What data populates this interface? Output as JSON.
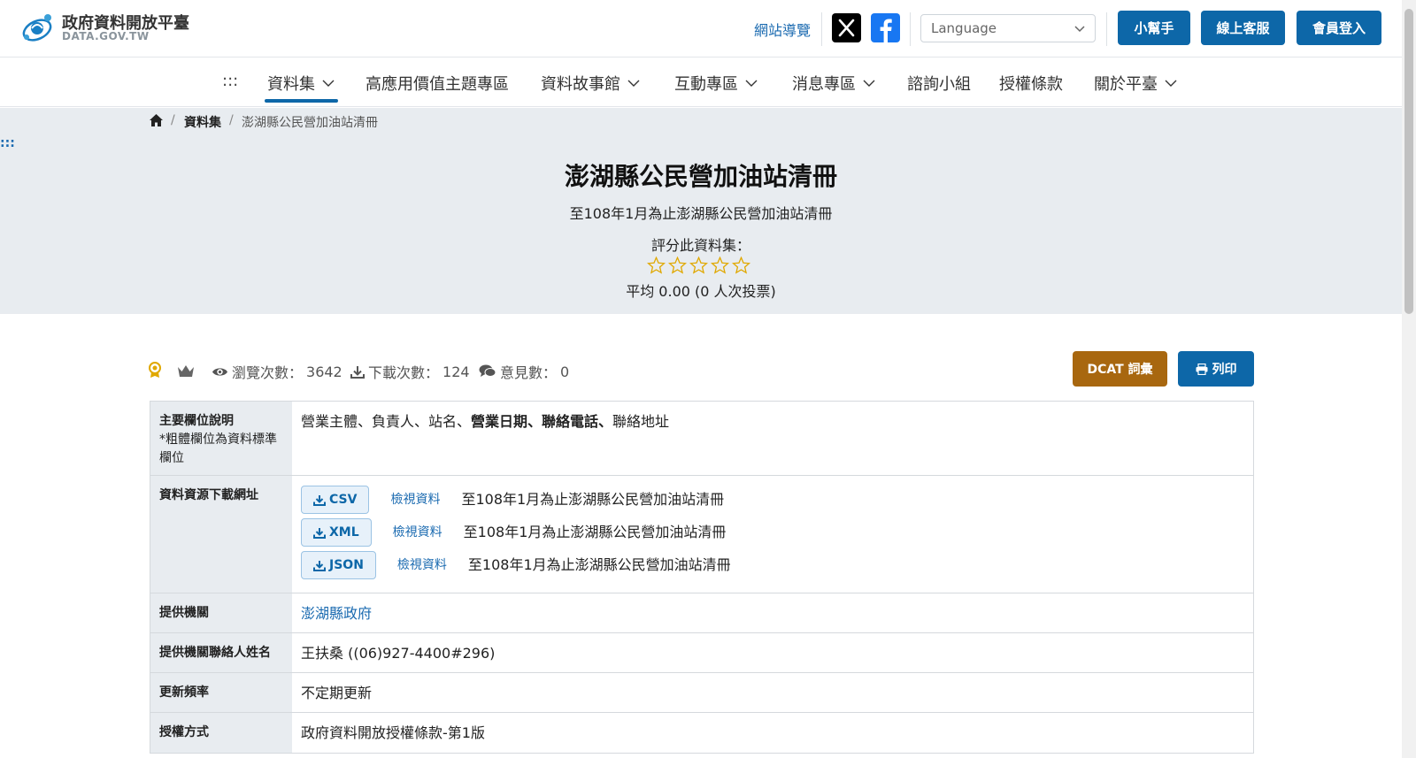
{
  "header": {
    "logo_title": "政府資料開放平臺",
    "logo_sub": "DATA.GOV.TW",
    "sitemap": "網站導覽",
    "language_placeholder": "Language",
    "buttons": {
      "helper": "小幫手",
      "service": "線上客服",
      "login": "會員登入"
    }
  },
  "nav": {
    "skip": ":::",
    "items": [
      "資料集",
      "高應用價值主題專區",
      "資料故事館",
      "互動專區",
      "消息專區",
      "諮詢小組",
      "授權條款",
      "關於平臺"
    ]
  },
  "breadcrumb": {
    "level1": "資料集",
    "current": "澎湖縣公民營加油站清冊"
  },
  "hero": {
    "skip": ":::",
    "title": "澎湖縣公民營加油站清冊",
    "description": "至108年1月為止澎湖縣公民營加油站清冊",
    "rate_label": "評分此資料集：",
    "rating_value": 0,
    "rating_max": 5,
    "average": "平均 0.00 (0 人次投票)"
  },
  "stats": {
    "views_label": "瀏覽次數：",
    "views": "3642",
    "downloads_label": "下載次數：",
    "downloads": "124",
    "comments_label": "意見數：",
    "comments": "0"
  },
  "actions": {
    "dcat": "DCAT 詞彙",
    "print": "列印"
  },
  "table": {
    "fields": {
      "label": "主要欄位說明",
      "note": "*粗體欄位為資料標準欄位",
      "plain1": "營業主體、負責人、站名、",
      "bold": "營業日期、聯絡電話、",
      "plain2": "聯絡地址"
    },
    "resources": {
      "label": "資料資源下載網址",
      "view_label": "檢視資料",
      "items": [
        {
          "format": "CSV",
          "desc": "至108年1月為止澎湖縣公民營加油站清冊"
        },
        {
          "format": "XML",
          "desc": "至108年1月為止澎湖縣公民營加油站清冊"
        },
        {
          "format": "JSON",
          "desc": "至108年1月為止澎湖縣公民營加油站清冊"
        }
      ]
    },
    "provider": {
      "label": "提供機關",
      "value": "澎湖縣政府"
    },
    "contact": {
      "label": "提供機關聯絡人姓名",
      "value": "王扶桑 ((06)927-4400#296)"
    },
    "frequency": {
      "label": "更新頻率",
      "value": "不定期更新"
    },
    "license": {
      "label": "授權方式",
      "value": "政府資料開放授權條款-第1版"
    }
  },
  "colors": {
    "primary": "#0d67a8",
    "dcat": "#a8670f",
    "hero_bg": "#e8ecf0",
    "star": "#e0a800"
  },
  "icons": [
    "logo-icon",
    "x-icon",
    "facebook-icon",
    "chevron-down-icon",
    "home-icon",
    "star-icon",
    "award-icon",
    "crown-icon",
    "eye-icon",
    "download-icon",
    "comments-icon",
    "print-icon"
  ]
}
